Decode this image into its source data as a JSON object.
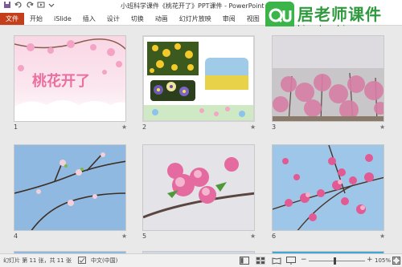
{
  "titlebar": {
    "title": "小班科学课件《桃花开了》PPT课件 - PowerPoint",
    "qa_icons": [
      "save-icon",
      "undo-icon",
      "redo-icon",
      "present-icon",
      "more-icon"
    ]
  },
  "ribbon": {
    "file_label": "文件",
    "tabs": [
      "开始",
      "iSlide",
      "插入",
      "设计",
      "切换",
      "动画",
      "幻灯片放映",
      "审阅",
      "视图"
    ]
  },
  "watermark": {
    "logo_text": "Qu",
    "title": "居老师课件",
    "url": "kj.qulaoshi.com"
  },
  "slides": [
    {
      "number": "1",
      "title_text": "桃花开了",
      "star": "★"
    },
    {
      "number": "2",
      "star": "★"
    },
    {
      "number": "3",
      "star": "★"
    },
    {
      "number": "4",
      "star": "★"
    },
    {
      "number": "5",
      "star": "★"
    },
    {
      "number": "6",
      "star": "★"
    }
  ],
  "statusbar": {
    "slide_info": "幻灯片 第 11 张，共 11 张",
    "language": "中文(中国)",
    "zoom_level": "105%",
    "zoom_minus": "−",
    "zoom_plus": "+"
  },
  "colors": {
    "file_tab": "#c43e1c",
    "watermark_green": "#2f9a3d",
    "peach_pink": "#e889b0"
  }
}
